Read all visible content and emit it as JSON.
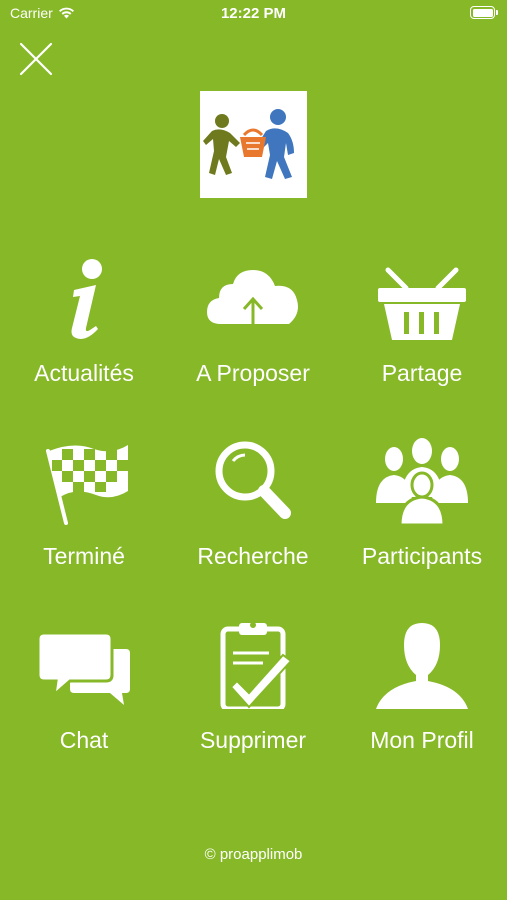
{
  "status_bar": {
    "carrier": "Carrier",
    "time": "12:22 PM"
  },
  "menu": {
    "items": [
      {
        "label": "Actualités",
        "icon": "info-icon"
      },
      {
        "label": "A Proposer",
        "icon": "cloud-upload-icon"
      },
      {
        "label": "Partage",
        "icon": "basket-icon"
      },
      {
        "label": "Terminé",
        "icon": "checkered-flag-icon"
      },
      {
        "label": "Recherche",
        "icon": "search-icon"
      },
      {
        "label": "Participants",
        "icon": "group-icon"
      },
      {
        "label": "Chat",
        "icon": "chat-bubbles-icon"
      },
      {
        "label": "Supprimer",
        "icon": "clipboard-check-icon"
      },
      {
        "label": "Mon Profil",
        "icon": "user-icon"
      }
    ]
  },
  "footer": {
    "copyright": "© proapplimob"
  },
  "colors": {
    "background": "#86b827",
    "foreground": "#ffffff"
  }
}
